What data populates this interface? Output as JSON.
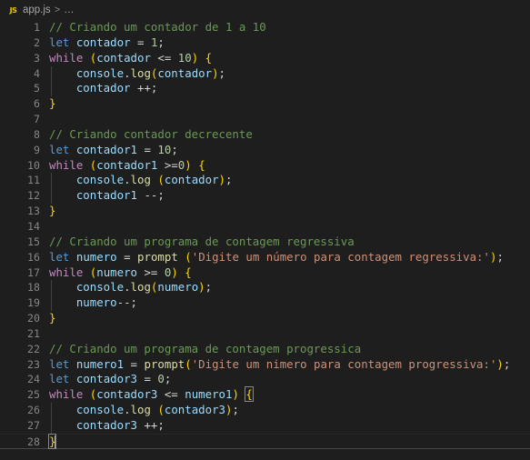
{
  "window": {
    "background_color": "#1e1e1e",
    "editor_background": "#1e1e1e"
  },
  "breadcrumb": {
    "file_icon_label": "JS",
    "file_name": "app.js",
    "separator": ">",
    "overflow": "…"
  },
  "gutter": {
    "line_number_color": "#858585"
  },
  "colors": {
    "comment": "#6a9955",
    "keyword": "#569cd6",
    "control_keyword": "#c586c0",
    "variable": "#9cdcfe",
    "function": "#dcdcaa",
    "number": "#b5cea8",
    "string": "#ce9178",
    "punctuation": "#d4d4d4",
    "bracket_yellow": "#ffd700",
    "bracket_pink": "#da70d6",
    "indent_guide": "#404040",
    "current_line_border": "#474747"
  },
  "editor": {
    "language": "JavaScript",
    "total_lines": 28,
    "current_line": 28,
    "lines": [
      {
        "n": "1",
        "text": "// Criando um contador de 1 a 10"
      },
      {
        "n": "2",
        "text": "let contador = 1;"
      },
      {
        "n": "3",
        "text": "while (contador <= 10) {"
      },
      {
        "n": "4",
        "text": "    console.log(contador);"
      },
      {
        "n": "5",
        "text": "    contador ++;"
      },
      {
        "n": "6",
        "text": "}"
      },
      {
        "n": "7",
        "text": ""
      },
      {
        "n": "8",
        "text": "// Criando contador decrecente"
      },
      {
        "n": "9",
        "text": "let contador1 = 10;"
      },
      {
        "n": "10",
        "text": "while (contador1 >=0) {"
      },
      {
        "n": "11",
        "text": "    console.log (contador);"
      },
      {
        "n": "12",
        "text": "    contador1 --;"
      },
      {
        "n": "13",
        "text": "}"
      },
      {
        "n": "14",
        "text": ""
      },
      {
        "n": "15",
        "text": "// Criando um programa de contagem regressiva"
      },
      {
        "n": "16",
        "text": "let numero = prompt ('Digite um número para contagem regressiva:');"
      },
      {
        "n": "17",
        "text": "while (numero >= 0) {"
      },
      {
        "n": "18",
        "text": "    console.log(numero);"
      },
      {
        "n": "19",
        "text": "    numero--;"
      },
      {
        "n": "20",
        "text": "}"
      },
      {
        "n": "21",
        "text": ""
      },
      {
        "n": "22",
        "text": "// Criando um programa de contagem progressica"
      },
      {
        "n": "23",
        "text": "let numero1 = prompt('Digite um nimero para contagem progressiva:');"
      },
      {
        "n": "24",
        "text": "let contador3 = 0;"
      },
      {
        "n": "25",
        "text": "while (contador3 <= numero1) {"
      },
      {
        "n": "26",
        "text": "    console.log (contador3);"
      },
      {
        "n": "27",
        "text": "    contador3 ++;"
      },
      {
        "n": "28",
        "text": "}"
      }
    ],
    "tokens": {
      "l1": [
        [
          "// Criando um contador de 1 a 10",
          "t-comment"
        ]
      ],
      "l2": [
        [
          "let",
          "t-keyword"
        ],
        [
          " ",
          "t-plain"
        ],
        [
          "contador",
          "t-var"
        ],
        [
          " ",
          "t-plain"
        ],
        [
          "=",
          "t-plain"
        ],
        [
          " ",
          "t-plain"
        ],
        [
          "1",
          "t-num"
        ],
        [
          ";",
          "t-plain"
        ]
      ],
      "l3": [
        [
          "while",
          "t-control"
        ],
        [
          " ",
          "t-plain"
        ],
        [
          "(",
          "t-paren1"
        ],
        [
          "contador",
          "t-var"
        ],
        [
          " <= ",
          "t-plain"
        ],
        [
          "10",
          "t-num"
        ],
        [
          ")",
          "t-paren1"
        ],
        [
          " ",
          "t-plain"
        ],
        [
          "{",
          "t-paren1"
        ]
      ],
      "l4": [
        [
          "    ",
          "t-plain"
        ],
        [
          "console",
          "t-obj"
        ],
        [
          ".",
          "t-plain"
        ],
        [
          "log",
          "t-func"
        ],
        [
          "(",
          "t-paren1"
        ],
        [
          "contador",
          "t-var"
        ],
        [
          ")",
          "t-paren1"
        ],
        [
          ";",
          "t-plain"
        ]
      ],
      "l5": [
        [
          "    ",
          "t-plain"
        ],
        [
          "contador",
          "t-var"
        ],
        [
          " ",
          "t-plain"
        ],
        [
          "++",
          "t-plain"
        ],
        [
          ";",
          "t-plain"
        ]
      ],
      "l6": [
        [
          "}",
          "t-paren1"
        ]
      ],
      "l8": [
        [
          "// Criando contador decrecente",
          "t-comment"
        ]
      ],
      "l9": [
        [
          "let",
          "t-keyword"
        ],
        [
          " ",
          "t-plain"
        ],
        [
          "contador1",
          "t-var"
        ],
        [
          " ",
          "t-plain"
        ],
        [
          "=",
          "t-plain"
        ],
        [
          " ",
          "t-plain"
        ],
        [
          "10",
          "t-num"
        ],
        [
          ";",
          "t-plain"
        ]
      ],
      "l10": [
        [
          "while",
          "t-control"
        ],
        [
          " ",
          "t-plain"
        ],
        [
          "(",
          "t-paren1"
        ],
        [
          "contador1",
          "t-var"
        ],
        [
          " >=",
          "t-plain"
        ],
        [
          "0",
          "t-num"
        ],
        [
          ")",
          "t-paren1"
        ],
        [
          " ",
          "t-plain"
        ],
        [
          "{",
          "t-paren1"
        ]
      ],
      "l11": [
        [
          "    ",
          "t-plain"
        ],
        [
          "console",
          "t-obj"
        ],
        [
          ".",
          "t-plain"
        ],
        [
          "log",
          "t-func"
        ],
        [
          " ",
          "t-plain"
        ],
        [
          "(",
          "t-paren1"
        ],
        [
          "contador",
          "t-var"
        ],
        [
          ")",
          "t-paren1"
        ],
        [
          ";",
          "t-plain"
        ]
      ],
      "l12": [
        [
          "    ",
          "t-plain"
        ],
        [
          "contador1",
          "t-var"
        ],
        [
          " ",
          "t-plain"
        ],
        [
          "--",
          "t-plain"
        ],
        [
          ";",
          "t-plain"
        ]
      ],
      "l13": [
        [
          "}",
          "t-paren1"
        ]
      ],
      "l15": [
        [
          "// Criando um programa de contagem regressiva",
          "t-comment"
        ]
      ],
      "l16": [
        [
          "let",
          "t-keyword"
        ],
        [
          " ",
          "t-plain"
        ],
        [
          "numero",
          "t-var"
        ],
        [
          " ",
          "t-plain"
        ],
        [
          "=",
          "t-plain"
        ],
        [
          " ",
          "t-plain"
        ],
        [
          "prompt",
          "t-func"
        ],
        [
          " ",
          "t-plain"
        ],
        [
          "(",
          "t-paren1"
        ],
        [
          "'Digite um número para contagem regressiva:'",
          "t-str"
        ],
        [
          ")",
          "t-paren1"
        ],
        [
          ";",
          "t-plain"
        ]
      ],
      "l17": [
        [
          "while",
          "t-control"
        ],
        [
          " ",
          "t-plain"
        ],
        [
          "(",
          "t-paren1"
        ],
        [
          "numero",
          "t-var"
        ],
        [
          " >= ",
          "t-plain"
        ],
        [
          "0",
          "t-num"
        ],
        [
          ")",
          "t-paren1"
        ],
        [
          " ",
          "t-plain"
        ],
        [
          "{",
          "t-paren1"
        ]
      ],
      "l18": [
        [
          "    ",
          "t-plain"
        ],
        [
          "console",
          "t-obj"
        ],
        [
          ".",
          "t-plain"
        ],
        [
          "log",
          "t-func"
        ],
        [
          "(",
          "t-paren1"
        ],
        [
          "numero",
          "t-var"
        ],
        [
          ")",
          "t-paren1"
        ],
        [
          ";",
          "t-plain"
        ]
      ],
      "l19": [
        [
          "    ",
          "t-plain"
        ],
        [
          "numero",
          "t-var"
        ],
        [
          "--",
          "t-plain"
        ],
        [
          ";",
          "t-plain"
        ]
      ],
      "l20": [
        [
          "}",
          "t-paren1"
        ]
      ],
      "l22": [
        [
          "// Criando um programa de contagem progressica",
          "t-comment"
        ]
      ],
      "l23": [
        [
          "let",
          "t-keyword"
        ],
        [
          " ",
          "t-plain"
        ],
        [
          "numero1",
          "t-var"
        ],
        [
          " ",
          "t-plain"
        ],
        [
          "=",
          "t-plain"
        ],
        [
          " ",
          "t-plain"
        ],
        [
          "prompt",
          "t-func"
        ],
        [
          "(",
          "t-paren1"
        ],
        [
          "'Digite um nimero para contagem progressiva:'",
          "t-str"
        ],
        [
          ")",
          "t-paren1"
        ],
        [
          ";",
          "t-plain"
        ]
      ],
      "l24": [
        [
          "let",
          "t-keyword"
        ],
        [
          " ",
          "t-plain"
        ],
        [
          "contador3",
          "t-var"
        ],
        [
          " ",
          "t-plain"
        ],
        [
          "=",
          "t-plain"
        ],
        [
          " ",
          "t-plain"
        ],
        [
          "0",
          "t-num"
        ],
        [
          ";",
          "t-plain"
        ]
      ],
      "l25": [
        [
          "while",
          "t-control"
        ],
        [
          " ",
          "t-plain"
        ],
        [
          "(",
          "t-paren1"
        ],
        [
          "contador3",
          "t-var"
        ],
        [
          " <= ",
          "t-plain"
        ],
        [
          "numero1",
          "t-var"
        ],
        [
          ")",
          "t-paren1"
        ],
        [
          " ",
          "t-plain"
        ],
        [
          "{",
          "t-paren1 bmatch"
        ]
      ],
      "l26": [
        [
          "    ",
          "t-plain"
        ],
        [
          "console",
          "t-obj"
        ],
        [
          ".",
          "t-plain"
        ],
        [
          "log",
          "t-func"
        ],
        [
          " ",
          "t-plain"
        ],
        [
          "(",
          "t-paren1"
        ],
        [
          "contador3",
          "t-var"
        ],
        [
          ")",
          "t-paren1"
        ],
        [
          ";",
          "t-plain"
        ]
      ],
      "l27": [
        [
          "    ",
          "t-plain"
        ],
        [
          "contador3",
          "t-var"
        ],
        [
          " ",
          "t-plain"
        ],
        [
          "++",
          "t-plain"
        ],
        [
          ";",
          "t-plain"
        ]
      ],
      "l28": [
        [
          "}",
          "t-paren1 bmatch"
        ]
      ]
    }
  }
}
